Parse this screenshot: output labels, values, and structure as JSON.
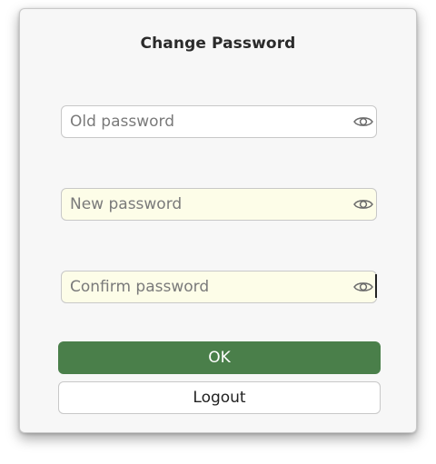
{
  "dialog": {
    "title": "Change Password",
    "fields": {
      "old_password": {
        "placeholder": "Old password",
        "icon": "eye-icon"
      },
      "new_password": {
        "placeholder": "New password",
        "icon": "eye-icon"
      },
      "confirm_password": {
        "placeholder": "Confirm password",
        "icon": "eye-icon"
      }
    },
    "buttons": {
      "ok_label": "OK",
      "logout_label": "Logout"
    }
  },
  "colors": {
    "ok_button": "#4a7f4a",
    "filled_field": "#fdfde8",
    "dialog_bg": "#f7f7f7"
  }
}
